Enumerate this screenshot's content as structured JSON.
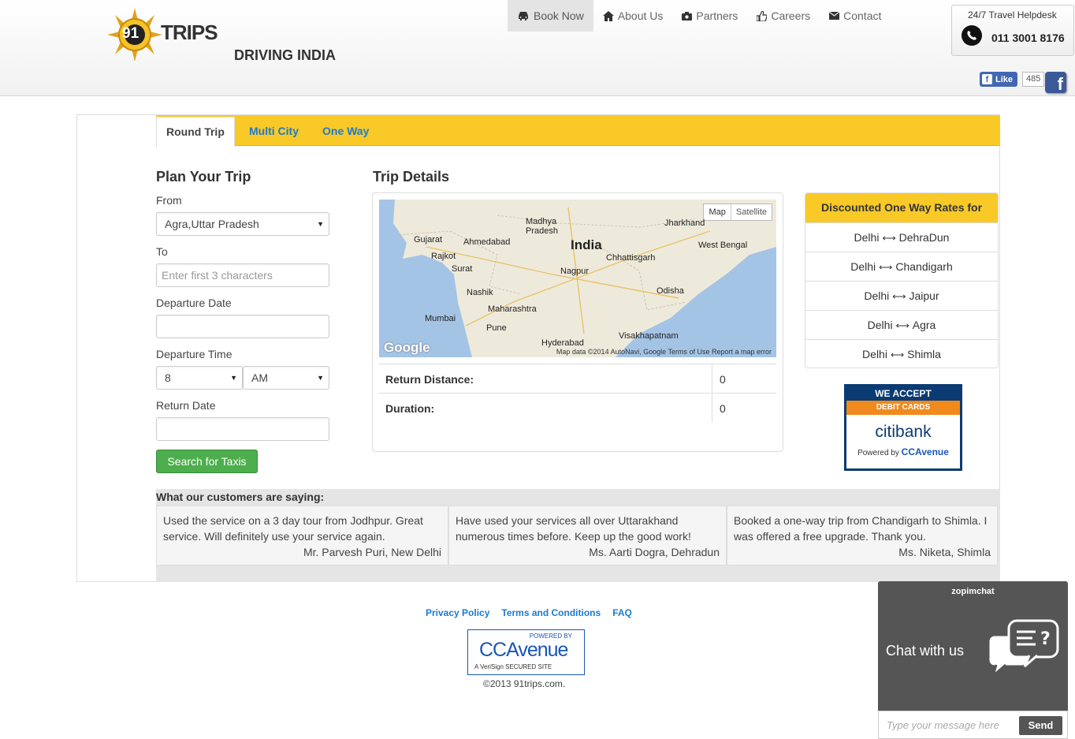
{
  "brand": {
    "logo_number": "91",
    "logo_text": "TRIPS",
    "tagline": "DRIVING INDIA"
  },
  "nav": [
    {
      "label": "Book Now",
      "icon": "car-icon",
      "active": true
    },
    {
      "label": "About Us",
      "icon": "home-icon"
    },
    {
      "label": "Partners",
      "icon": "camera-icon"
    },
    {
      "label": "Careers",
      "icon": "thumbs-up-icon"
    },
    {
      "label": "Contact",
      "icon": "envelope-icon"
    }
  ],
  "helpdesk": {
    "title": "24/7 Travel Helpdesk",
    "phone": "011 3001 8176"
  },
  "facebook": {
    "like_label": "Like",
    "count": "485"
  },
  "tabs": [
    "Round Trip",
    "Multi City",
    "One Way"
  ],
  "plan": {
    "title": "Plan Your Trip",
    "from_label": "From",
    "from_value": "Agra,Uttar Pradesh",
    "to_label": "To",
    "to_placeholder": "Enter first 3 characters",
    "departure_date_label": "Departure Date",
    "departure_time_label": "Departure Time",
    "hour_value": "8",
    "ampm_value": "AM",
    "return_date_label": "Return Date",
    "search_button": "Search for Taxis"
  },
  "trip": {
    "title": "Trip Details",
    "map": {
      "map_btn": "Map",
      "satellite_btn": "Satellite",
      "labels": [
        "Madhya Pradesh",
        "Jharkhand",
        "Gujarat",
        "Ahmedabad",
        "India",
        "West Bengal",
        "Rajkot",
        "Chhattisgarh",
        "Surat",
        "Nagpur",
        "Nashik",
        "Odisha",
        "Maharashtra",
        "Mumbai",
        "Pune",
        "Visakhapatnam",
        "Hyderabad"
      ],
      "footer": "Map data ©2014 AutoNavi, Google   Terms of Use   Report a map error",
      "google": "Google"
    },
    "return_distance_label": "Return Distance:",
    "return_distance_value": "0",
    "duration_label": "Duration:",
    "duration_value": "0"
  },
  "rates": {
    "title": "Discounted One Way Rates for",
    "routes": [
      {
        "from": "Delhi",
        "to": "DehraDun"
      },
      {
        "from": "Delhi",
        "to": "Chandigarh"
      },
      {
        "from": "Delhi",
        "to": "Jaipur"
      },
      {
        "from": "Delhi",
        "to": "Agra"
      },
      {
        "from": "Delhi",
        "to": "Shimla"
      }
    ]
  },
  "citi_ad": {
    "line1": "WE ACCEPT",
    "line2": "DEBIT CARDS",
    "bank": "citibank",
    "powered": "Powered by",
    "provider": "CCAvenue"
  },
  "testimonials": {
    "title": "What our customers are saying:",
    "items": [
      {
        "text": "Used the service on a 3 day tour from Jodhpur. Great service. Will definitely use your service again.",
        "author": "Mr. Parvesh Puri, New Delhi"
      },
      {
        "text": "Have used your services all over Uttarakhand numerous times before. Keep up the good work!",
        "author": "Ms. Aarti Dogra, Dehradun"
      },
      {
        "text": "Booked a one-way trip from Chandigarh to Shimla. I was offered a free upgrade. Thank you.",
        "author": "Ms. Niketa, Shimla"
      }
    ]
  },
  "footer": {
    "links": [
      "Privacy Policy",
      "Terms and Conditions",
      "FAQ"
    ],
    "badge_powered": "POWERED BY",
    "badge_name": "CCAvenue",
    "badge_secure": "A VeriSign SECURED SITE",
    "copyright": "©2013 91trips.com."
  },
  "chat": {
    "brand": "zopimchat",
    "label": "Chat with us",
    "placeholder": "Type your message here",
    "send": "Send"
  },
  "colors": {
    "accent_yellow": "#f9c928",
    "link_blue": "#1a7bd0",
    "button_green": "#4cae4c",
    "chat_bg": "#555555"
  }
}
